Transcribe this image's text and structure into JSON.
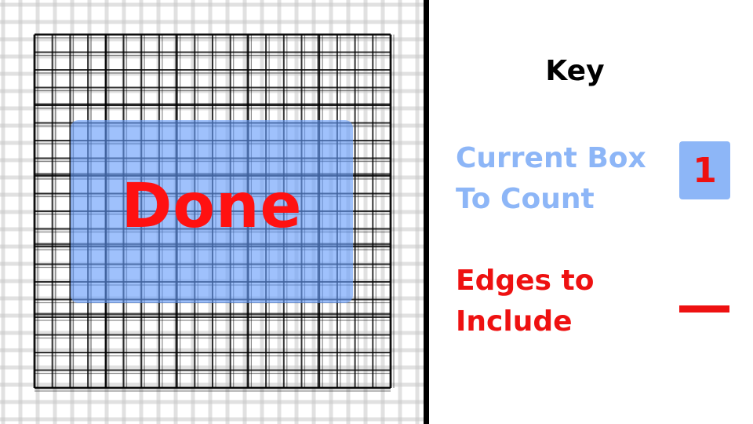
{
  "key": {
    "title": "Key",
    "current_box": {
      "line1": "Current Box",
      "line2": "To Count",
      "swatch_number": "1",
      "color": "#8db6f7"
    },
    "edges": {
      "line1": "Edges to",
      "line2": "Include",
      "color": "#ee1111"
    }
  },
  "overlay": {
    "label": "Done",
    "box_color": "#649bfa",
    "label_color": "#ff1111"
  },
  "grid": {
    "line_color": "#000000",
    "faint_line_color": "#c8c8c8"
  }
}
